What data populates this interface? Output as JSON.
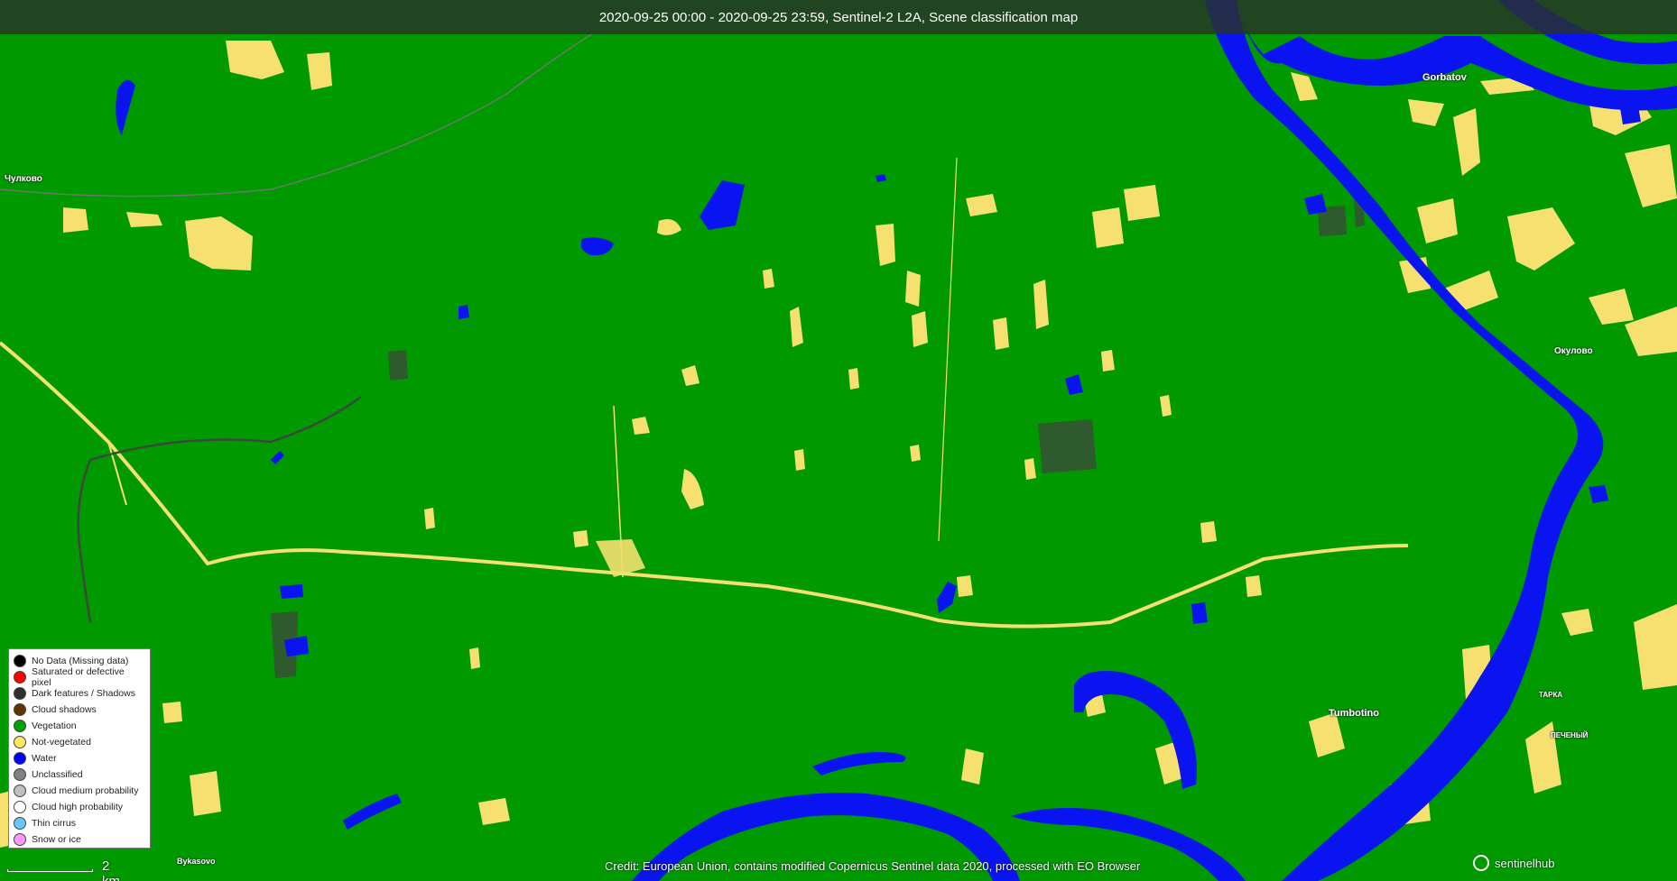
{
  "title": "2020-09-25 00:00 - 2020-09-25 23:59, Sentinel-2 L2A, Scene classification map",
  "places": [
    {
      "name": "Gorbatov"
    },
    {
      "name": "Чулково"
    },
    {
      "name": "Окулово"
    },
    {
      "name": "Tumbotino"
    },
    {
      "name": "Bykasovo"
    },
    {
      "name": "ТАРКА"
    },
    {
      "name": "ПЕЧЕНЫЙ"
    }
  ],
  "legend": {
    "items": [
      {
        "label": "No Data (Missing data)",
        "color": "#000000"
      },
      {
        "label": "Saturated or defective pixel",
        "color": "#ff0000"
      },
      {
        "label": "Dark features / Shadows",
        "color": "#2f2f2f"
      },
      {
        "label": "Cloud shadows",
        "color": "#643200"
      },
      {
        "label": "Vegetation",
        "color": "#00a000"
      },
      {
        "label": "Not-vegetated",
        "color": "#ffe65a"
      },
      {
        "label": "Water",
        "color": "#0000ff"
      },
      {
        "label": "Unclassified",
        "color": "#808080"
      },
      {
        "label": "Cloud medium probability",
        "color": "#c0c0c0"
      },
      {
        "label": "Cloud high probability",
        "color": "#ffffff"
      },
      {
        "label": "Thin cirrus",
        "color": "#64c8ff"
      },
      {
        "label": "Snow or ice",
        "color": "#ff96ff"
      }
    ]
  },
  "scale": {
    "label": "2 km"
  },
  "credit": "Credit: European Union, contains modified Copernicus Sentinel data 2020, processed with EO Browser",
  "logos": {
    "text": "sentinelhub"
  },
  "colors": {
    "vegetation": "#009a00",
    "water": "#0a14f0",
    "not_vegetated": "#f5e070",
    "dark": "#3a4a3a"
  }
}
